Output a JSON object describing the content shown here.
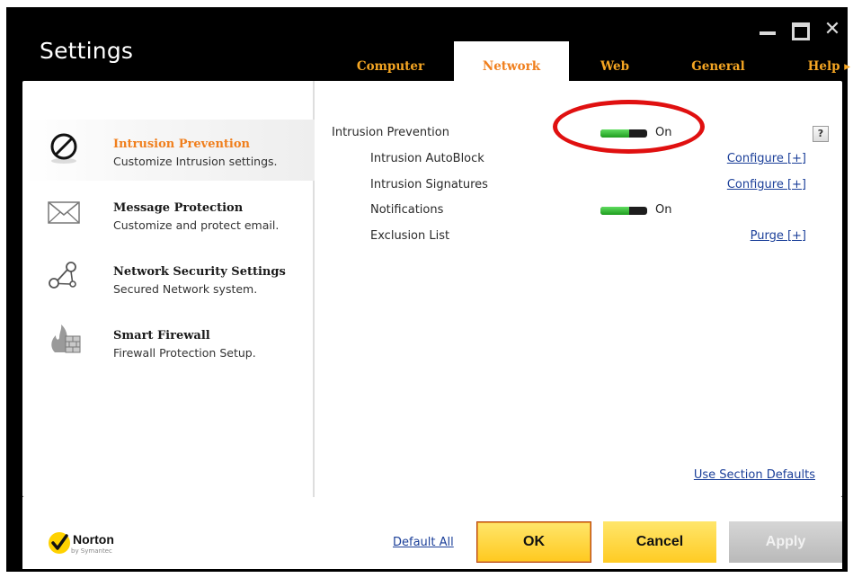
{
  "window": {
    "title": "Settings",
    "controls": {
      "minimize_icon": "minimize-icon",
      "maximize_icon": "maximize-icon",
      "close_label": "✕"
    }
  },
  "tabs": [
    {
      "label": "Computer",
      "active": false
    },
    {
      "label": "Network",
      "active": true
    },
    {
      "label": "Web",
      "active": false
    },
    {
      "label": "General",
      "active": false
    },
    {
      "label": "Help ▸",
      "active": false
    }
  ],
  "sidebar": {
    "items": [
      {
        "title": "Intrusion Prevention",
        "subtitle": "Customize Intrusion settings.",
        "icon": "prohibited-icon",
        "active": true
      },
      {
        "title": "Message Protection",
        "subtitle": "Customize and protect email.",
        "icon": "envelope-icon",
        "active": false
      },
      {
        "title": "Network Security Settings",
        "subtitle": "Secured Network system.",
        "icon": "network-nodes-icon",
        "active": false
      },
      {
        "title": "Smart Firewall",
        "subtitle": "Firewall Protection Setup.",
        "icon": "firewall-icon",
        "active": false
      }
    ]
  },
  "settings": {
    "help_label": "?",
    "rows": [
      {
        "label": "Intrusion Prevention",
        "toggle": "On"
      },
      {
        "label": "Intrusion AutoBlock",
        "link": "Configure [+]"
      },
      {
        "label": "Intrusion Signatures",
        "link": "Configure [+]"
      },
      {
        "label": "Notifications",
        "toggle": "On"
      },
      {
        "label": "Exclusion List",
        "link": "Purge [+]"
      }
    ],
    "section_defaults_link": "Use Section Defaults"
  },
  "footer": {
    "logo_text": "Norton",
    "logo_sub": "by Symantec",
    "default_all_link": "Default All",
    "ok_label": "OK",
    "cancel_label": "Cancel",
    "apply_label": "Apply"
  },
  "colors": {
    "accent_orange": "#f07f1d",
    "tab_text": "#f5a623",
    "button_yellow": "#ffcb23",
    "toggle_green": "#2eb82e",
    "link_blue": "#1b3f99",
    "annotation_red": "#e01010"
  }
}
